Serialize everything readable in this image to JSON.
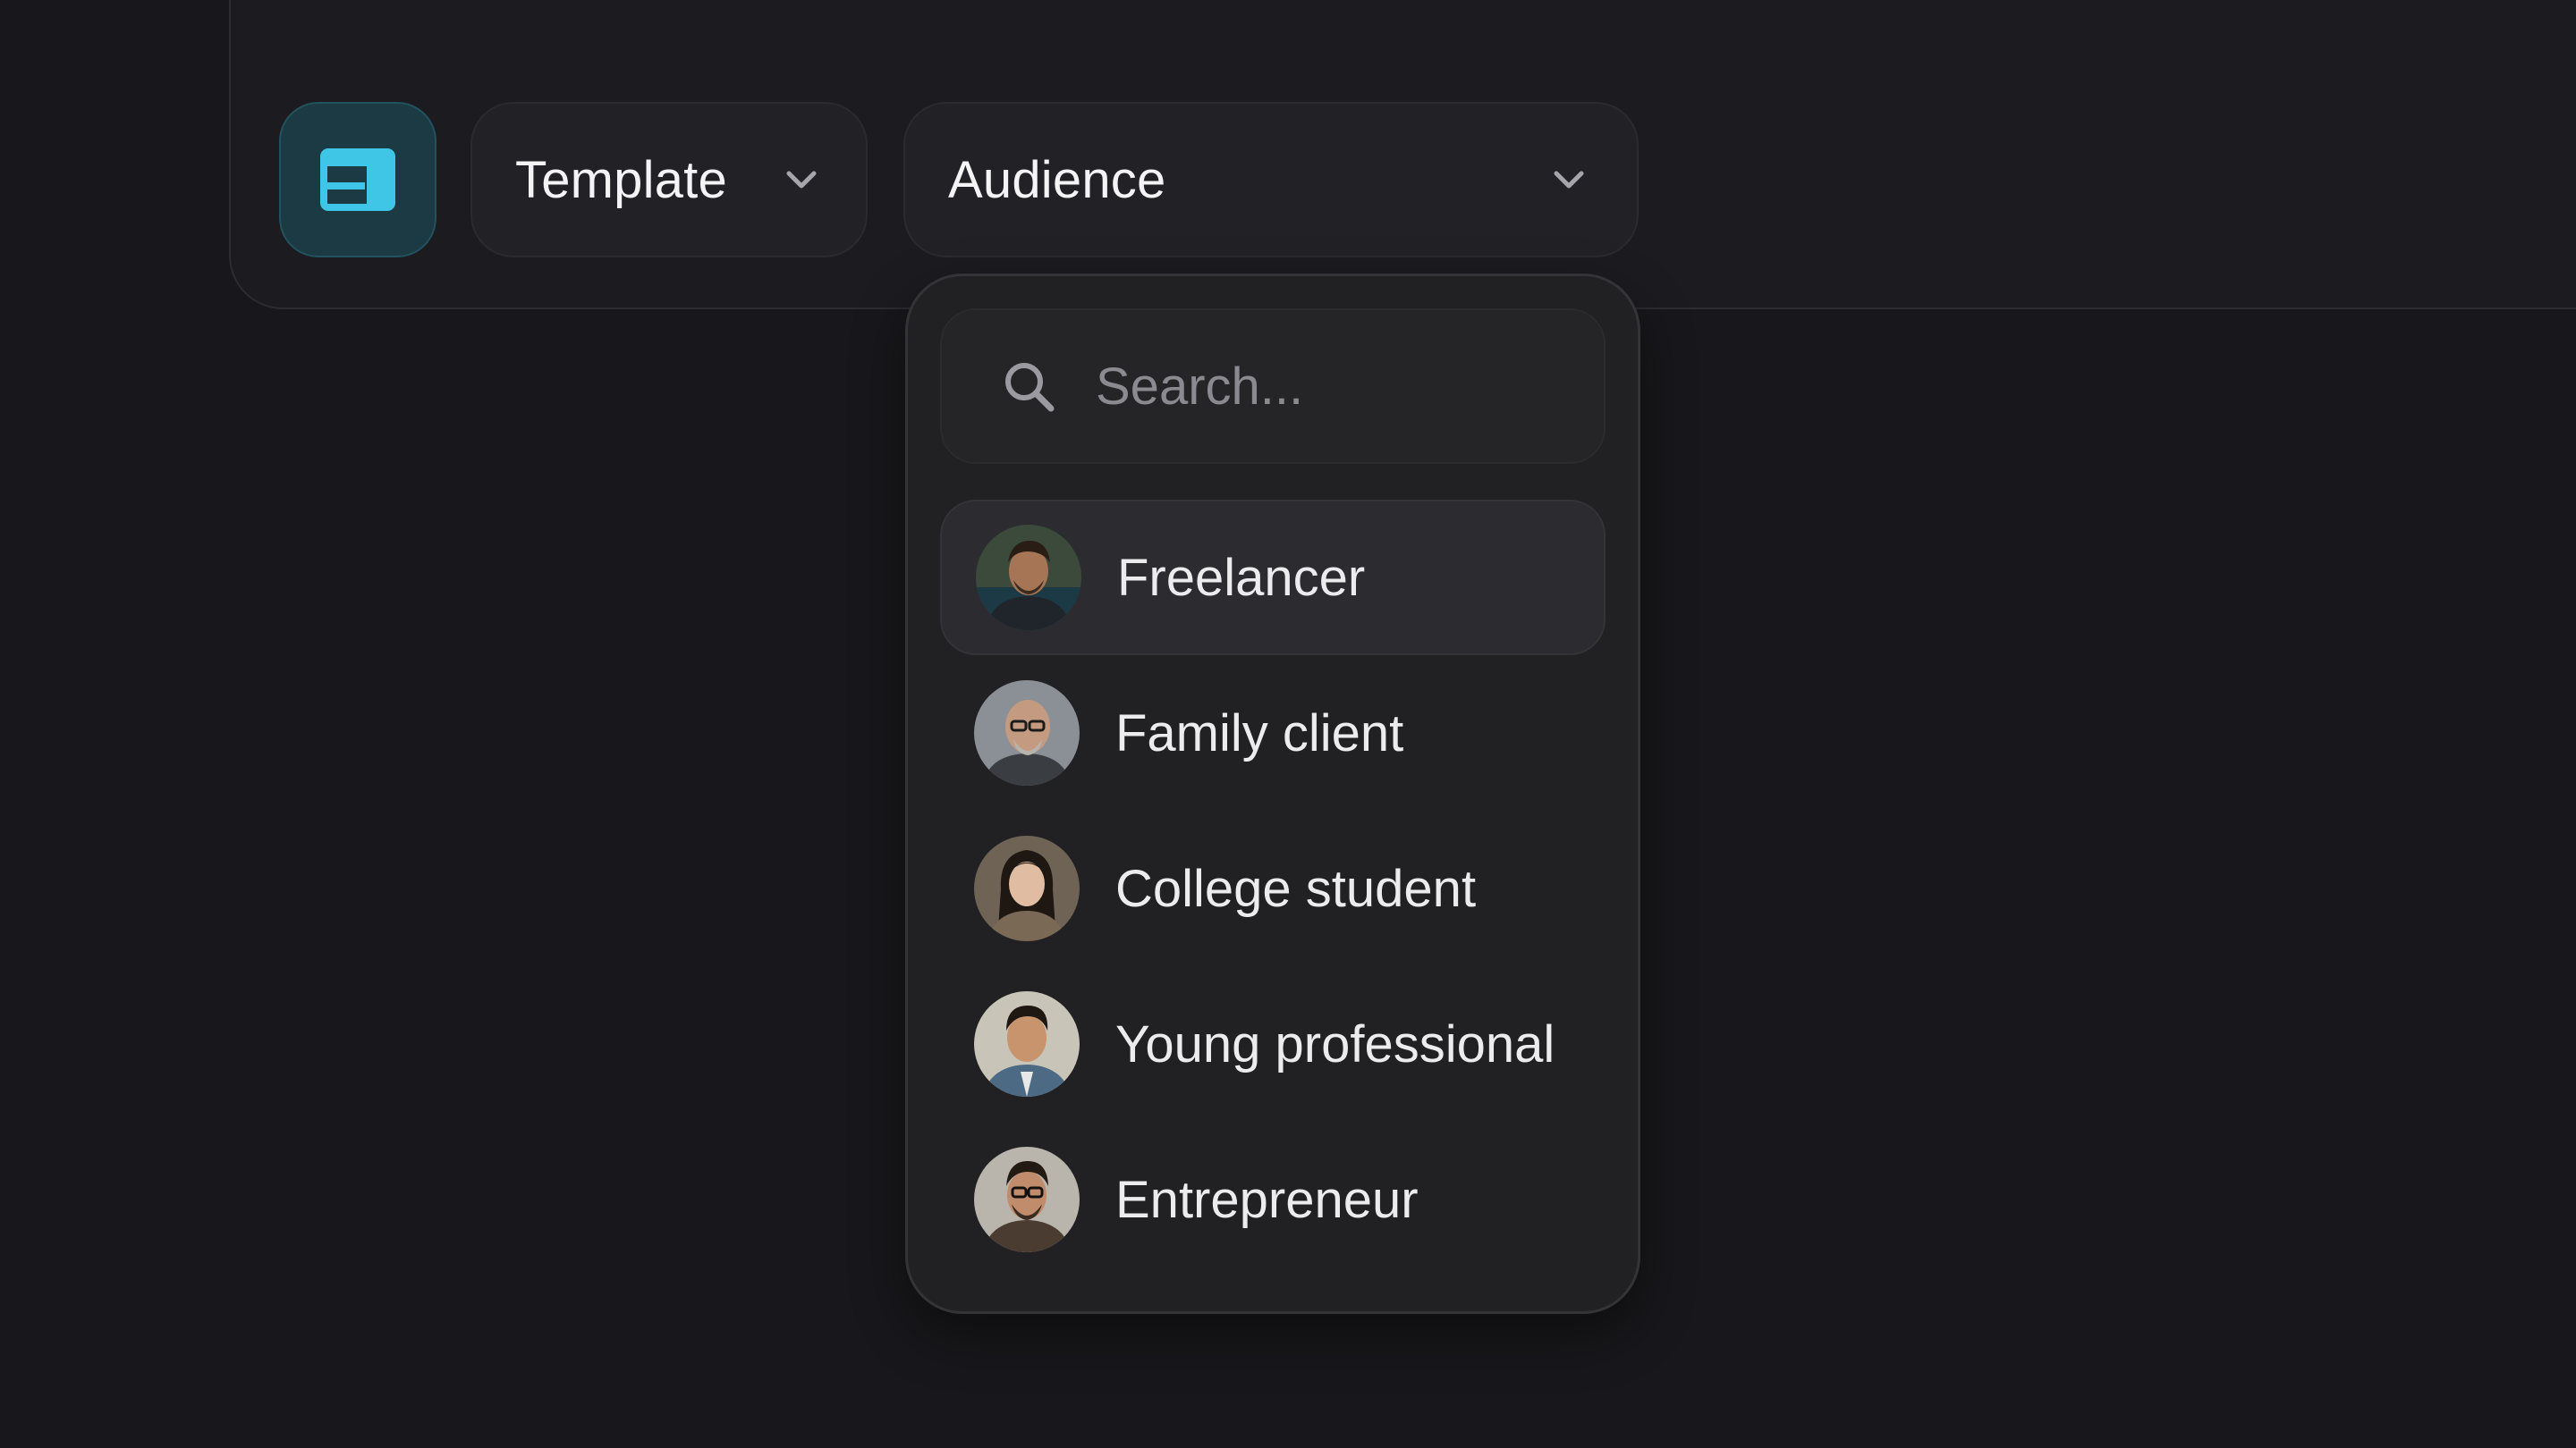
{
  "toolbar": {
    "layout_button": {
      "icon": "layout-panel-icon",
      "accent": "#3fc6e6",
      "background": "#1c3a44"
    },
    "template": {
      "label": "Template",
      "icon": "chevron-down-icon"
    },
    "audience": {
      "label": "Audience",
      "icon": "chevron-down-icon"
    }
  },
  "dropdown": {
    "search": {
      "placeholder": "Search...",
      "value": "",
      "icon": "search-icon"
    },
    "options": [
      {
        "label": "Freelancer",
        "highlighted": true,
        "avatar": "avatar-freelancer"
      },
      {
        "label": "Family client",
        "highlighted": false,
        "avatar": "avatar-family-client"
      },
      {
        "label": "College student",
        "highlighted": false,
        "avatar": "avatar-college-student"
      },
      {
        "label": "Young professional",
        "highlighted": false,
        "avatar": "avatar-young-professional"
      },
      {
        "label": "Entrepreneur",
        "highlighted": false,
        "avatar": "avatar-entrepreneur"
      }
    ]
  }
}
